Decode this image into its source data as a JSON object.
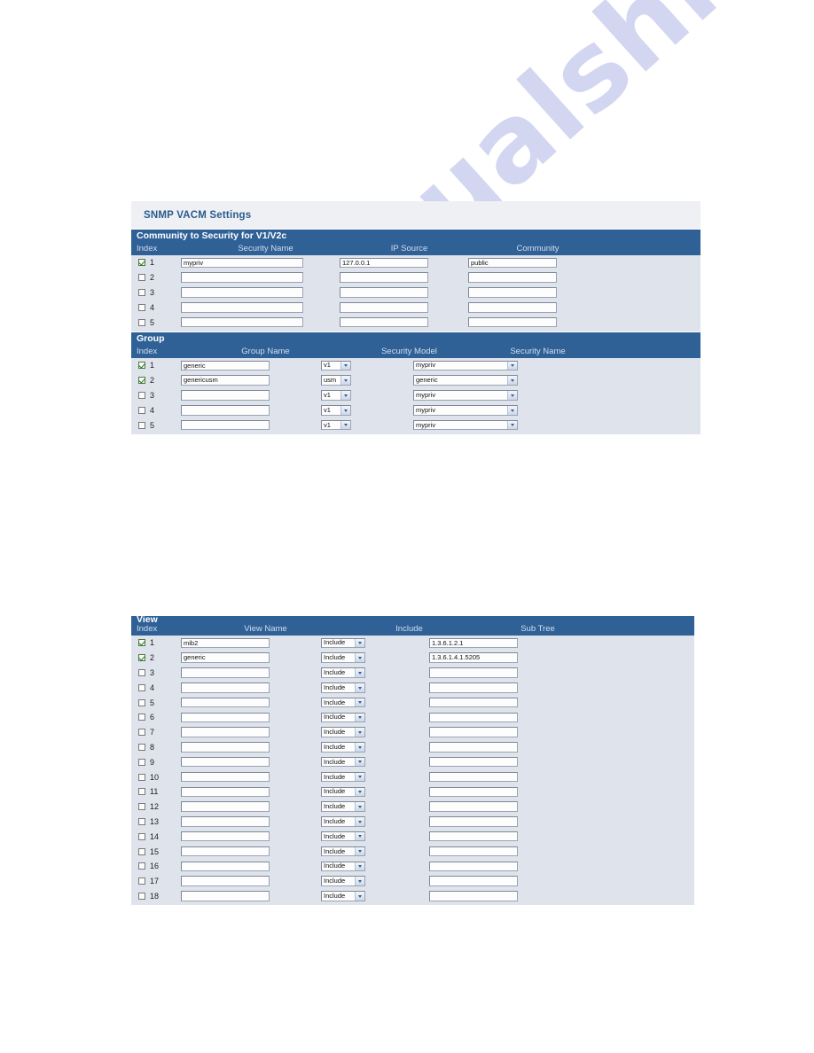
{
  "page": {
    "panel_title": "SNMP VACM Settings",
    "accent_color": "#2f6197",
    "panel_head_bg": "#eef0f3",
    "table_bg": "#dfe3ec",
    "title_color": "#2a5b8d"
  },
  "watermark": {
    "text": "manualshive.com"
  },
  "community_section": {
    "title": "Community to Security for V1/V2c",
    "headers": {
      "index": "Index",
      "security_name": "Security Name",
      "ip_source": "IP Source",
      "community": "Community"
    },
    "rows": [
      {
        "index": "1",
        "checked": true,
        "security_name": "mypriv",
        "ip_source": "127.0.0.1",
        "community": "public"
      },
      {
        "index": "2",
        "checked": false,
        "security_name": "",
        "ip_source": "",
        "community": ""
      },
      {
        "index": "3",
        "checked": false,
        "security_name": "",
        "ip_source": "",
        "community": ""
      },
      {
        "index": "4",
        "checked": false,
        "security_name": "",
        "ip_source": "",
        "community": ""
      },
      {
        "index": "5",
        "checked": false,
        "security_name": "",
        "ip_source": "",
        "community": ""
      }
    ]
  },
  "group_section": {
    "title": "Group",
    "headers": {
      "index": "Index",
      "group_name": "Group Name",
      "security_model": "Security Model",
      "security_name": "Security Name"
    },
    "rows": [
      {
        "index": "1",
        "checked": true,
        "group_name": "generic",
        "security_model": "v1",
        "security_name": "mypriv"
      },
      {
        "index": "2",
        "checked": true,
        "group_name": "genericusm",
        "security_model": "usm",
        "security_name": "generic"
      },
      {
        "index": "3",
        "checked": false,
        "group_name": "",
        "security_model": "v1",
        "security_name": "mypriv"
      },
      {
        "index": "4",
        "checked": false,
        "group_name": "",
        "security_model": "v1",
        "security_name": "mypriv"
      },
      {
        "index": "5",
        "checked": false,
        "group_name": "",
        "security_model": "v1",
        "security_name": "mypriv"
      }
    ]
  },
  "view_section": {
    "title": "View",
    "headers": {
      "index": "Index",
      "view_name": "View Name",
      "include": "Include",
      "sub_tree": "Sub Tree"
    },
    "rows": [
      {
        "index": "1",
        "checked": true,
        "view_name": "mib2",
        "include": "Include",
        "sub_tree": "1.3.6.1.2.1"
      },
      {
        "index": "2",
        "checked": true,
        "view_name": "generic",
        "include": "Include",
        "sub_tree": "1.3.6.1.4.1.5205"
      },
      {
        "index": "3",
        "checked": false,
        "view_name": "",
        "include": "Include",
        "sub_tree": ""
      },
      {
        "index": "4",
        "checked": false,
        "view_name": "",
        "include": "Include",
        "sub_tree": ""
      },
      {
        "index": "5",
        "checked": false,
        "view_name": "",
        "include": "Include",
        "sub_tree": ""
      },
      {
        "index": "6",
        "checked": false,
        "view_name": "",
        "include": "Include",
        "sub_tree": ""
      },
      {
        "index": "7",
        "checked": false,
        "view_name": "",
        "include": "Include",
        "sub_tree": ""
      },
      {
        "index": "8",
        "checked": false,
        "view_name": "",
        "include": "Include",
        "sub_tree": ""
      },
      {
        "index": "9",
        "checked": false,
        "view_name": "",
        "include": "Include",
        "sub_tree": ""
      },
      {
        "index": "10",
        "checked": false,
        "view_name": "",
        "include": "Include",
        "sub_tree": ""
      },
      {
        "index": "11",
        "checked": false,
        "view_name": "",
        "include": "Include",
        "sub_tree": ""
      },
      {
        "index": "12",
        "checked": false,
        "view_name": "",
        "include": "Include",
        "sub_tree": ""
      },
      {
        "index": "13",
        "checked": false,
        "view_name": "",
        "include": "Include",
        "sub_tree": ""
      },
      {
        "index": "14",
        "checked": false,
        "view_name": "",
        "include": "Include",
        "sub_tree": ""
      },
      {
        "index": "15",
        "checked": false,
        "view_name": "",
        "include": "Include",
        "sub_tree": ""
      },
      {
        "index": "16",
        "checked": false,
        "view_name": "",
        "include": "Include",
        "sub_tree": ""
      },
      {
        "index": "17",
        "checked": false,
        "view_name": "",
        "include": "Include",
        "sub_tree": ""
      },
      {
        "index": "18",
        "checked": false,
        "view_name": "",
        "include": "Include",
        "sub_tree": ""
      }
    ]
  }
}
